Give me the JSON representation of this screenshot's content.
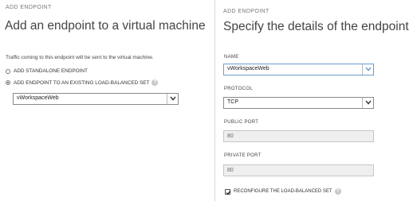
{
  "left": {
    "eyebrow": "ADD ENDPOINT",
    "title": "Add an endpoint to a virtual machine",
    "description": "Traffic coming to this endpoint will be sent to the virtual machine.",
    "options": [
      {
        "label": "ADD STANDALONE ENDPOINT",
        "checked": false
      },
      {
        "label": "ADD ENDPOINT TO AN EXISTING LOAD-BALANCED SET",
        "checked": true
      }
    ],
    "help_icon": "?",
    "set_select": {
      "value": "vWorkspaceWeb"
    }
  },
  "right": {
    "eyebrow": "ADD ENDPOINT",
    "title": "Specify the details of the endpoint",
    "name": {
      "label": "NAME",
      "value": "vWorkspaceWeb"
    },
    "protocol": {
      "label": "PROTOCOL",
      "value": "TCP"
    },
    "public_port": {
      "label": "PUBLIC PORT",
      "value": "80"
    },
    "private_port": {
      "label": "PRIVATE PORT",
      "value": "80"
    },
    "reconfigure": {
      "label": "RECONFIGURE THE LOAD-BALANCED SET",
      "checked": true
    },
    "help_icon": "?"
  },
  "colors": {
    "accent": "#6a9bd1",
    "border": "#8a8a8a",
    "disabled_bg": "#efefef"
  }
}
